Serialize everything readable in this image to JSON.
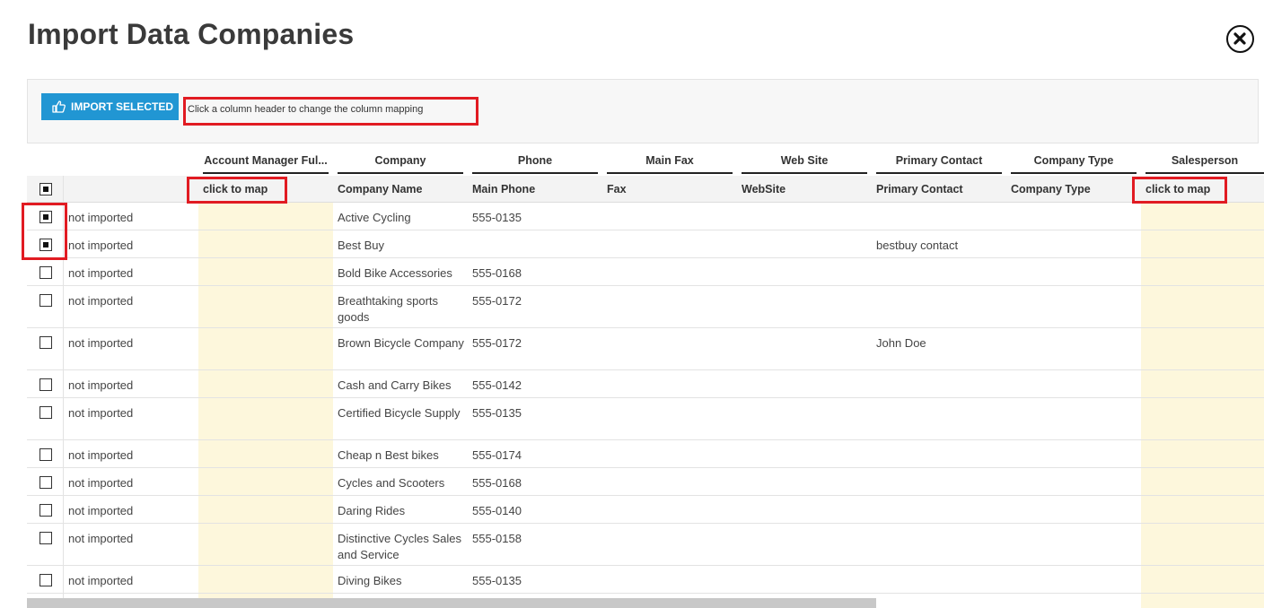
{
  "dialog": {
    "title": "Import Data Companies"
  },
  "toolbar": {
    "import_label": "IMPORT SELECTED",
    "hint": "Click a column header to change the column mapping"
  },
  "columns": [
    {
      "header": "Account Manager Ful...",
      "mapping": "click to map",
      "highlighted": true
    },
    {
      "header": "Company",
      "mapping": "Company Name",
      "highlighted": false
    },
    {
      "header": "Phone",
      "mapping": "Main Phone",
      "highlighted": false
    },
    {
      "header": "Main Fax",
      "mapping": "Fax",
      "highlighted": false
    },
    {
      "header": "Web Site",
      "mapping": "WebSite",
      "highlighted": false
    },
    {
      "header": "Primary Contact",
      "mapping": "Primary Contact",
      "highlighted": false
    },
    {
      "header": "Company Type",
      "mapping": "Company Type",
      "highlighted": false
    },
    {
      "header": "Salesperson",
      "mapping": "click to map",
      "highlighted": true
    }
  ],
  "select_all_checked": true,
  "rows": [
    {
      "checked": true,
      "status": "not imported",
      "company": "Active Cycling",
      "phone": "555-0135",
      "contact": ""
    },
    {
      "checked": true,
      "status": "not imported",
      "company": "Best Buy",
      "phone": "",
      "contact": "bestbuy contact"
    },
    {
      "checked": false,
      "status": "not imported",
      "company": "Bold Bike Accessories",
      "phone": "555-0168",
      "contact": ""
    },
    {
      "checked": false,
      "status": "not imported",
      "company": "Breathtaking sports goods",
      "phone": "555-0172",
      "contact": ""
    },
    {
      "checked": false,
      "status": "not imported",
      "company": "Brown Bicycle Company",
      "phone": "555-0172",
      "contact": "John Doe"
    },
    {
      "checked": false,
      "status": "not imported",
      "company": "Cash and Carry Bikes",
      "phone": "555-0142",
      "contact": ""
    },
    {
      "checked": false,
      "status": "not imported",
      "company": "Certified Bicycle Supply",
      "phone": "555-0135",
      "contact": ""
    },
    {
      "checked": false,
      "status": "not imported",
      "company": "Cheap n Best bikes",
      "phone": "555-0174",
      "contact": ""
    },
    {
      "checked": false,
      "status": "not imported",
      "company": "Cycles and Scooters",
      "phone": "555-0168",
      "contact": ""
    },
    {
      "checked": false,
      "status": "not imported",
      "company": "Daring Rides",
      "phone": "555-0140",
      "contact": ""
    },
    {
      "checked": false,
      "status": "not imported",
      "company": "Distinctive Cycles Sales and Service",
      "phone": "555-0158",
      "contact": ""
    },
    {
      "checked": false,
      "status": "not imported",
      "company": "Diving Bikes",
      "phone": "555-0135",
      "contact": ""
    }
  ],
  "colors": {
    "accent": "#2196d3",
    "highlight": "#fdf7dc",
    "annotation": "#e11b22"
  }
}
